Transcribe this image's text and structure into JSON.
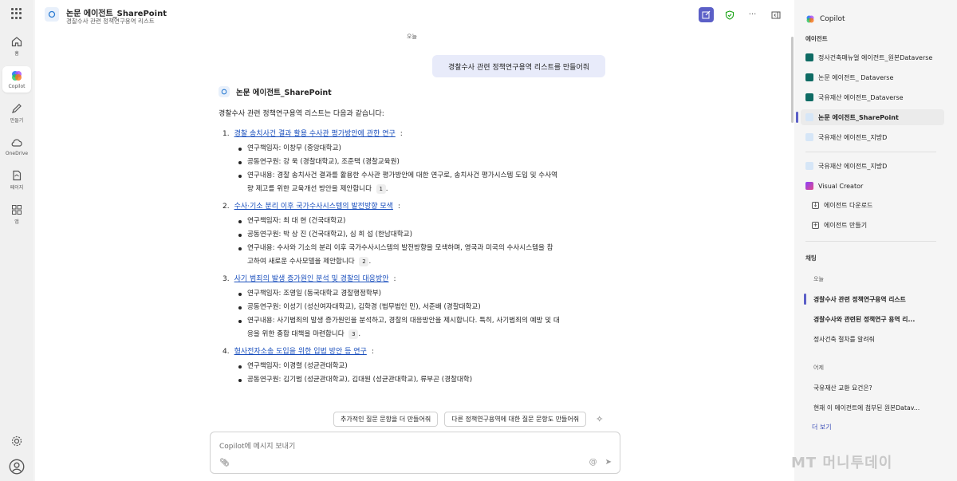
{
  "rail": {
    "items": [
      {
        "label": "홈",
        "icon": "home-icon"
      },
      {
        "label": "Copilot",
        "icon": "copilot-icon"
      },
      {
        "label": "만들기",
        "icon": "pen-icon"
      },
      {
        "label": "OneDrive",
        "icon": "cloud-icon"
      },
      {
        "label": "페이지",
        "icon": "page-icon"
      },
      {
        "label": "앱",
        "icon": "apps-icon"
      }
    ]
  },
  "header": {
    "title": "논문 에이전트_SharePoint",
    "subtitle": "경찰수사 관련 정책연구용역 리스트"
  },
  "conversation": {
    "day_label": "오늘",
    "user_message": "경찰수사 관련 정책연구용역 리스트를 만들어줘",
    "agent_name": "논문 에이전트_SharePoint",
    "intro": "경찰수사 관련 정책연구용역 리스트는 다음과 같습니다:",
    "studies": [
      {
        "num": "1.",
        "title": "경찰 송치사건 결과 활용 수사관 평가방안에 관한 연구",
        "lines": [
          "연구책임자: 이창무 (중앙대학교)",
          "공동연구원: 강 욱 (경찰대학교), 조준택 (경찰교육원)",
          "연구내용: 경찰 송치사건 결과를 활용한 수사관 평가방안에 대한 연구로, 송치사건 평가시스템 도입 및 수사역",
          "량 제고를 위한 교육개선 방안을 제안합니다"
        ],
        "cite": "1"
      },
      {
        "num": "2.",
        "title": "수사·기소 분리 이후 국가수사시스템의 발전방향 모색",
        "lines": [
          "연구책임자: 최 대 현 (건국대학교)",
          "공동연구원: 박 상 진 (건국대학교), 심 희 섭 (한남대학교)",
          "연구내용: 수사와 기소의 분리 이후 국가수사시스템의 발전방향을 모색하며, 영국과 미국의 수사시스템을 참",
          "고하여 새로운 수사모델을 제안합니다"
        ],
        "cite": "2"
      },
      {
        "num": "3.",
        "title": "사기 범죄의 발생 증가원인 분석 및 경찰의 대응방안",
        "lines": [
          "연구책임자: 조영일 (동국대학교 경찰행정학부)",
          "공동연구원: 이성기 (성신여자대학교), 김학경 (법무법인 민), 서준배 (경찰대학교)",
          "연구내용: 사기범죄의 발생 증가원인을 분석하고, 경찰의 대응방안을 제시합니다. 특히, 사기범죄의 예방 및 대",
          "응을 위한 종합 대책을 마련합니다"
        ],
        "cite": "3"
      },
      {
        "num": "4.",
        "title": "형사전자소송 도입을 위한 입법 방안 등 연구",
        "lines": [
          "연구책임자: 이경렬 (성균관대학교)",
          "공동연구원: 김기범 (성균관대학교), 김대원 (성균관대학교), 류부곤 (경찰대학)"
        ],
        "cite": ""
      }
    ]
  },
  "suggestions": [
    "추가적인 질문 문항을 더 만들어줘",
    "다른 정책연구용역에 대한 질문 문항도 만들어줘"
  ],
  "composer": {
    "placeholder": "Copilot에 메시지 보내기"
  },
  "sidebar": {
    "title": "Copilot",
    "agents_header": "에이전트",
    "agents": [
      "정사건축매뉴얼 에이전트_원본Dataverse",
      "논문 에이전트_ Dataverse",
      "국유재산 에이전트_Dataverse",
      "논문 에이전트_SharePoint",
      "국유재산 에이전트_지방D",
      "국유재산 에이전트_지방D",
      "Visual Creator"
    ],
    "actions": [
      "에이전트 다운로드",
      "에이전트 만들기"
    ],
    "chat_header": "채팅",
    "today": "오늘",
    "today_chats": [
      "경찰수사 관련 정책연구용역 리스트",
      "경찰수사와 관련된 정책연구 용역 리...",
      "정사건축 절차를 알려줘"
    ],
    "yesterday": "어제",
    "yesterday_chats": [
      "국유재산 교환 요건은?",
      "현재 이 에이전트에 첨부된 원본Datav..."
    ],
    "more": "더 보기"
  },
  "watermark": "MT 머니투데이",
  "colors": {
    "accent": "#5b5fc7",
    "link": "#1a4fbd"
  }
}
